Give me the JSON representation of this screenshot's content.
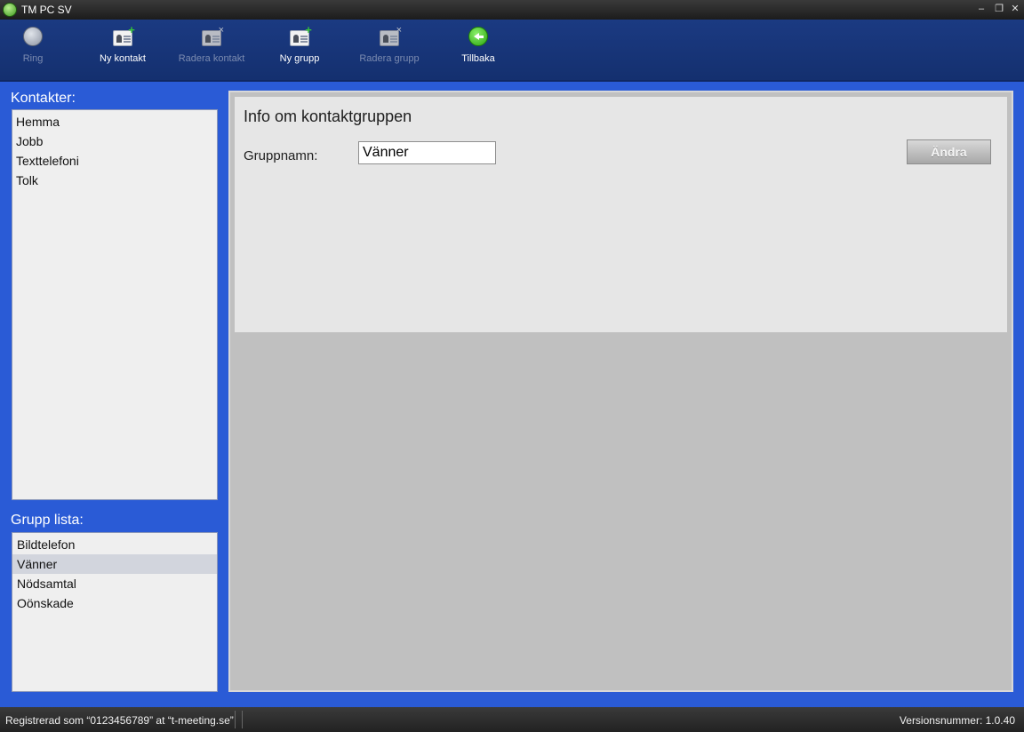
{
  "window": {
    "title": "TM PC SV"
  },
  "toolbar": {
    "buttons": [
      {
        "label": "Ring",
        "icon": "phone-globe-icon",
        "enabled": false
      },
      {
        "label": "Ny kontakt",
        "icon": "new-contact-icon",
        "enabled": true
      },
      {
        "label": "Radera kontakt",
        "icon": "delete-contact-icon",
        "enabled": false
      },
      {
        "label": "Ny grupp",
        "icon": "new-group-icon",
        "enabled": true
      },
      {
        "label": "Radera grupp",
        "icon": "delete-group-icon",
        "enabled": false
      },
      {
        "label": "Tillbaka",
        "icon": "back-arrow-icon",
        "enabled": true
      }
    ]
  },
  "contacts": {
    "label": "Kontakter:",
    "items": [
      "Hemma",
      "Jobb",
      "Texttelefoni",
      "Tolk"
    ]
  },
  "groups": {
    "label": "Grupp lista:",
    "items": [
      "Bildtelefon",
      "Vänner",
      "Nödsamtal",
      "Oönskade"
    ],
    "selected": "Vänner"
  },
  "info": {
    "heading": "Info om kontaktgruppen",
    "group_name_label": "Gruppnamn:",
    "group_name_value": "Vänner",
    "edit_button": "Ändra"
  },
  "status": {
    "registration": "Registrerad som “0123456789” at “t-meeting.se”",
    "version": "Versionsnummer: 1.0.40"
  },
  "colors": {
    "background": "#2a5bd6",
    "toolbar": "#1b3a82",
    "panel": "#e6e6e6"
  }
}
